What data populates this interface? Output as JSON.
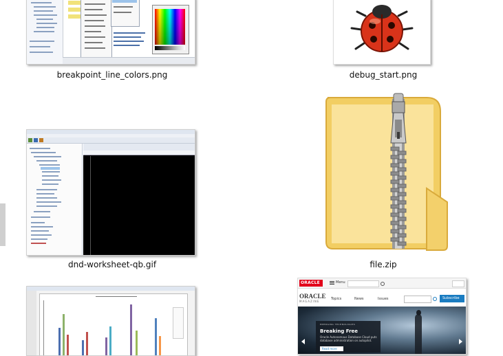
{
  "files": [
    {
      "name": "breakpoint_line_colors.png",
      "icon": "image-thumbnail"
    },
    {
      "name": "debug_start.png",
      "icon": "ladybug-icon"
    },
    {
      "name": "dnd-worksheet-qb.gif",
      "icon": "image-thumbnail"
    },
    {
      "name": "file.zip",
      "icon": "zip-folder-icon"
    },
    {
      "name": "",
      "icon": "chart-thumbnail"
    },
    {
      "name": "",
      "icon": "oracle-magazine-thumbnail"
    }
  ],
  "oracle": {
    "brand": "ORACLE",
    "menu": "Menu",
    "magazine_title": "ORACLE",
    "magazine_sub": "MAGAZINE",
    "nav": [
      "Topics",
      "News",
      "Issues"
    ],
    "subscribe": "Subscribe",
    "tag": "EMERGING TECHNOLOGIES",
    "headline": "Breaking Free",
    "subline": "Oracle Autonomous Database Cloud puts database administration on autopilot.",
    "cta": "Read more"
  },
  "colors": {
    "oracle_red": "#e2001a",
    "folder": "#f7d77a",
    "accent_blue": "#1a7cc1"
  }
}
